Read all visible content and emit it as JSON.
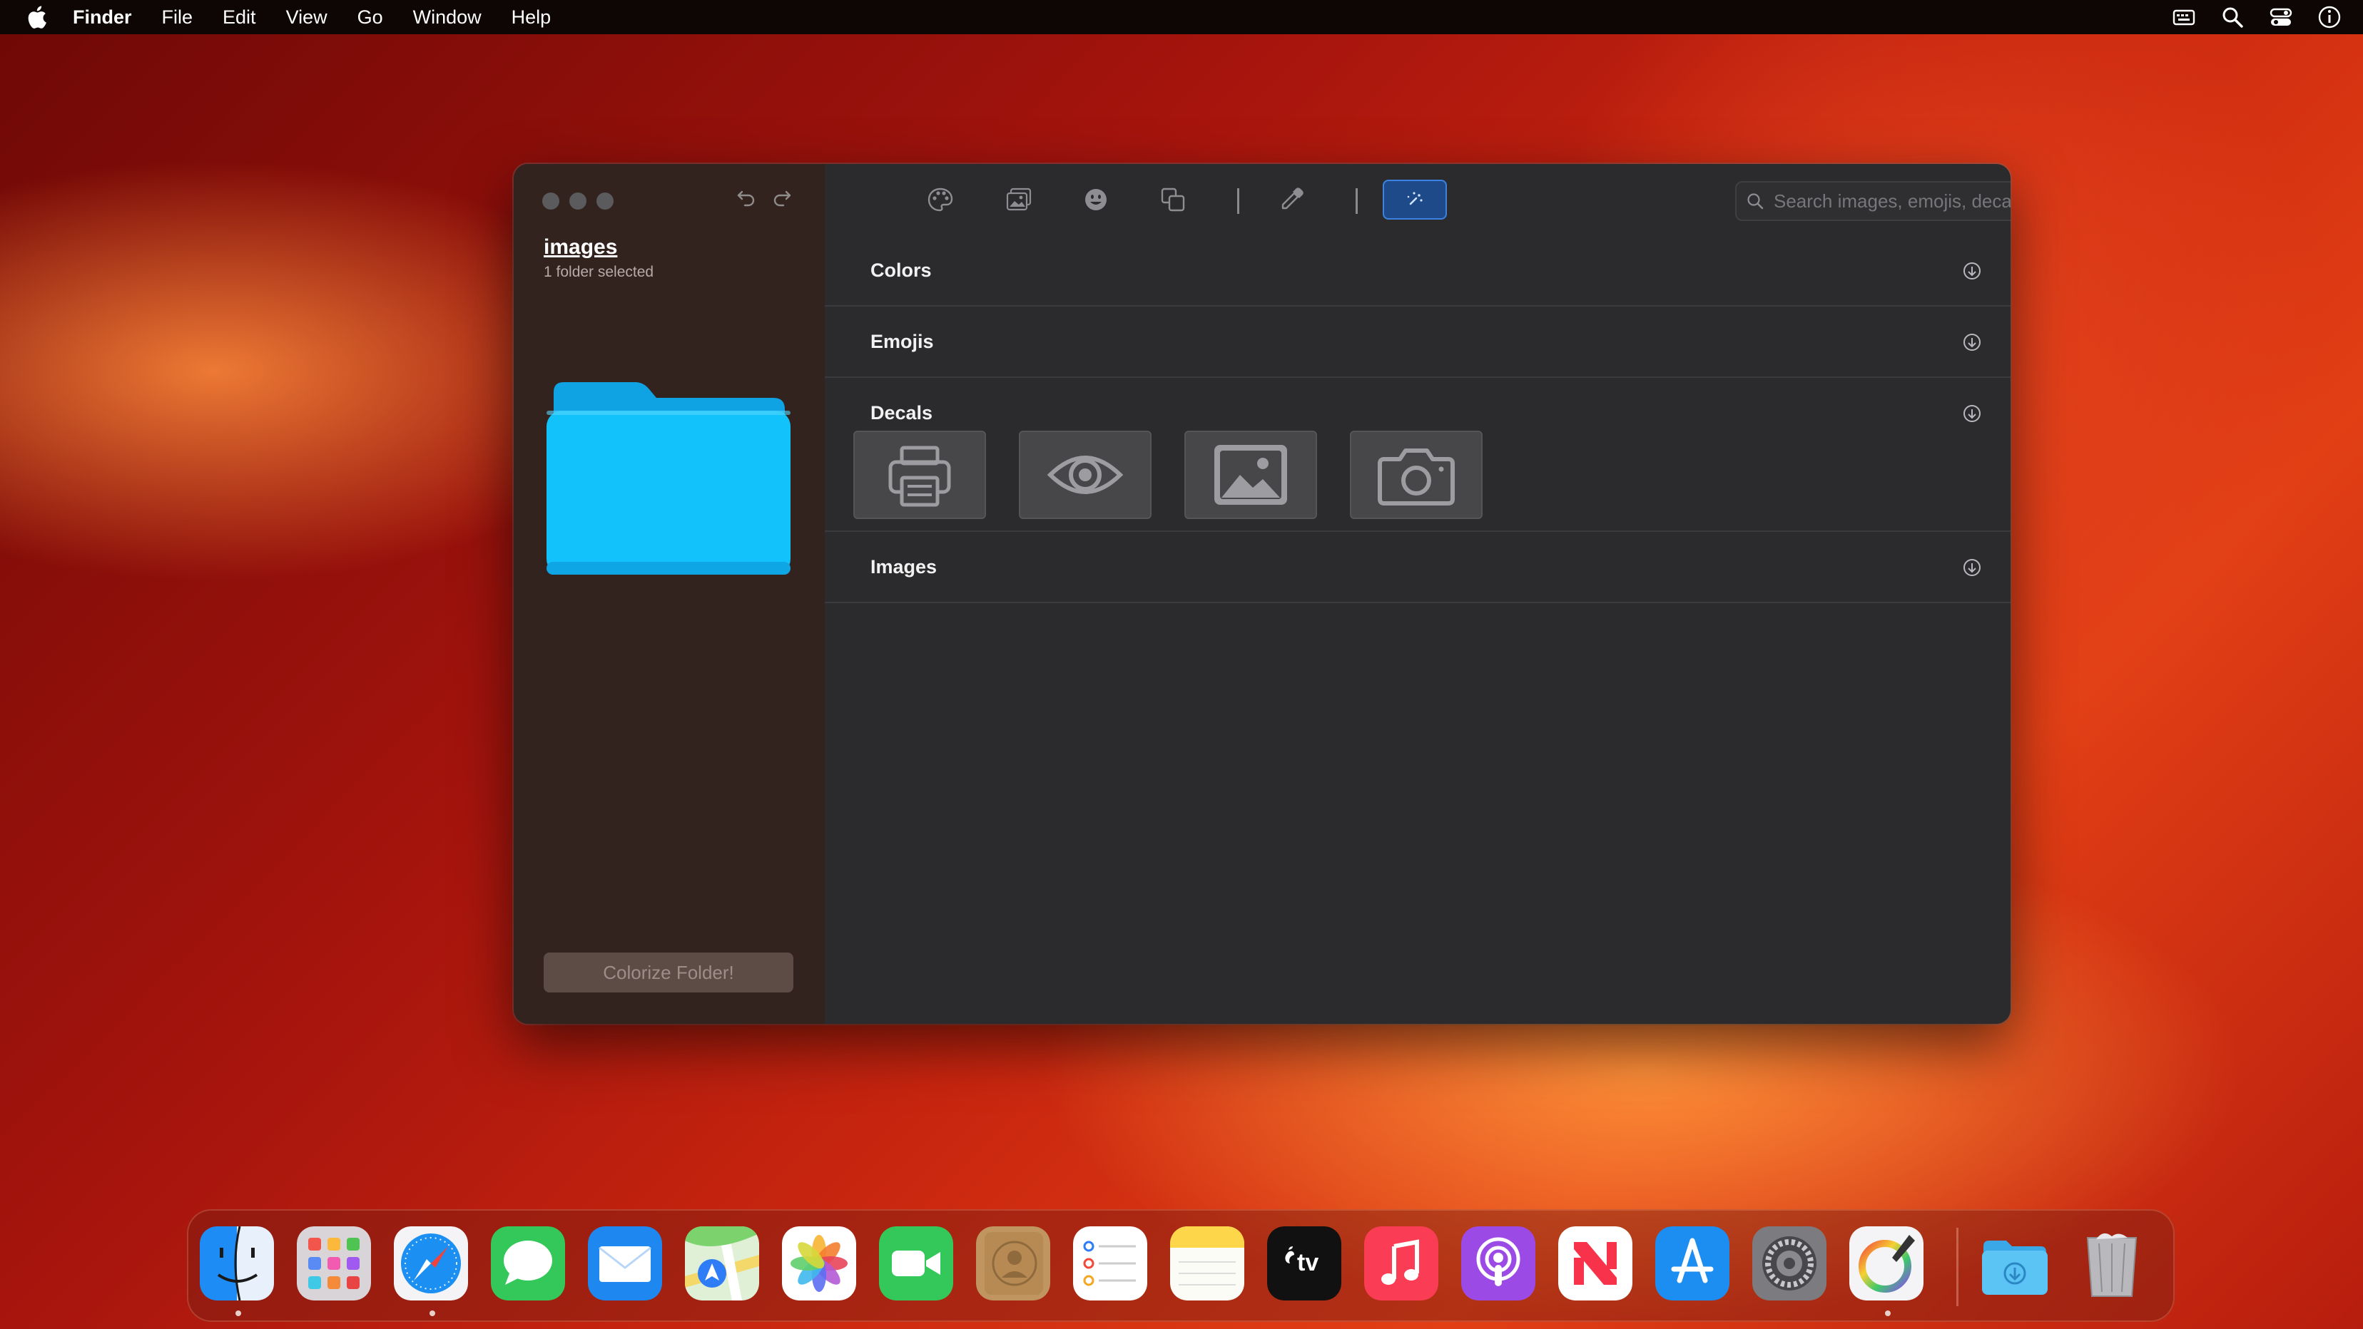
{
  "menubar": {
    "app_name": "Finder",
    "items": [
      "File",
      "Edit",
      "View",
      "Go",
      "Window",
      "Help"
    ],
    "status_icons": [
      "input-menu-icon",
      "spotlight-search-icon",
      "control-center-icon",
      "info-icon"
    ]
  },
  "window": {
    "sidebar": {
      "folder_name": "images",
      "selection_status": "1 folder selected",
      "folder_color": "#14c1f5",
      "colorize_button_label": "Colorize Folder!"
    },
    "toolbar": {
      "tools": [
        "palette-icon",
        "photos-icon",
        "emoji-icon",
        "decals-icon",
        "eyedropper-icon",
        "magic-wand-icon"
      ],
      "active_tool": "magic-wand-icon",
      "search_placeholder": "Search images, emojis, decals & keywords"
    },
    "sections": {
      "colors": "Colors",
      "emojis": "Emojis",
      "decals": "Decals",
      "images": "Images"
    },
    "decals": [
      "printer-icon",
      "eye-icon",
      "photo-icon",
      "camera-icon"
    ]
  },
  "dock": {
    "apps": [
      "Finder",
      "Launchpad",
      "Safari",
      "Messages",
      "Mail",
      "Maps",
      "Photos",
      "FaceTime",
      "Contacts",
      "Reminders",
      "Notes",
      "TV",
      "Music",
      "Podcasts",
      "News",
      "App Store",
      "System Settings",
      "Folder Colorizer"
    ],
    "tv_label": "tv",
    "running": [
      "Finder",
      "Safari",
      "Folder Colorizer"
    ],
    "right": [
      "Downloads",
      "Trash"
    ]
  }
}
